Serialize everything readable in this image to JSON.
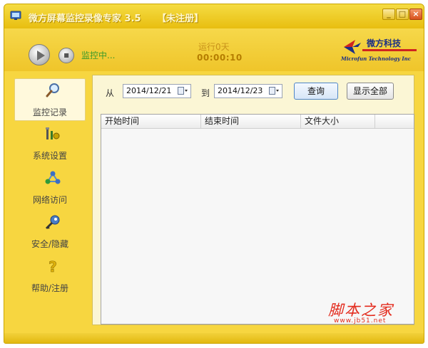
{
  "window": {
    "title": "微方屏幕监控录像专家 3.5",
    "registration": "【未注册】"
  },
  "toolbar": {
    "status": "监控中...",
    "run_days": "运行0天",
    "run_time": "00:00:10"
  },
  "brand": {
    "name": "微方科技",
    "subtitle": "Microfun Technology Inc"
  },
  "sidebar": {
    "items": [
      {
        "label": "监控记录",
        "icon": "magnifier-icon"
      },
      {
        "label": "系统设置",
        "icon": "tools-icon"
      },
      {
        "label": "网络访问",
        "icon": "network-icon"
      },
      {
        "label": "安全/隐藏",
        "icon": "key-icon"
      },
      {
        "label": "帮助/注册",
        "icon": "question-icon"
      }
    ]
  },
  "filter": {
    "from_label": "从",
    "from_date": "2014/12/21",
    "to_label": "到",
    "to_date": "2014/12/23",
    "query_button": "查询",
    "show_all_button": "显示全部"
  },
  "table": {
    "columns": [
      "开始时间",
      "结束时间",
      "文件大小"
    ],
    "rows": []
  },
  "watermark": {
    "title": "脚本之家",
    "url": "www.jb51.net"
  },
  "colors": {
    "frame": "#f7d640",
    "status_green": "#3d9a2a",
    "timer": "#b57d00",
    "brand_blue": "#1b2f86",
    "watermark_red": "#e32b1d"
  }
}
